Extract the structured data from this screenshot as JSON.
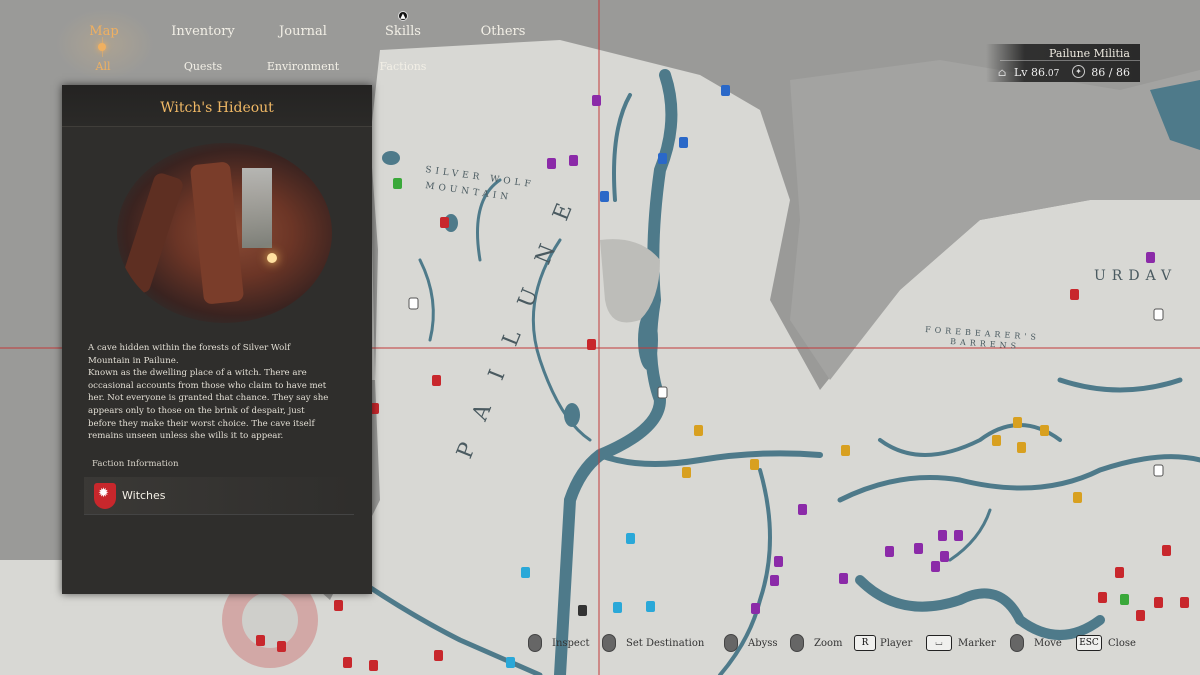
{
  "nav": {
    "main_tabs": [
      {
        "label": "Map",
        "active": true
      },
      {
        "label": "Inventory"
      },
      {
        "label": "Journal"
      },
      {
        "label": "Skills"
      },
      {
        "label": "Others"
      }
    ],
    "sub_tabs": [
      {
        "label": "All",
        "active": true
      },
      {
        "label": "Quests"
      },
      {
        "label": "Environment"
      },
      {
        "label": "Factions"
      }
    ]
  },
  "status": {
    "title": "Pailune Militia",
    "lv_label": "Lv",
    "lv_value": "86",
    "lv_fraction": ".07",
    "faction_value": "86  /  86"
  },
  "panel": {
    "title": "Witch's Hideout",
    "description": "A cave hidden within the forests of Silver Wolf\nMountain in Pailune.\nKnown as the dwelling place of a witch. There are\noccasional accounts from those who claim to have met\nher. Not everyone is granted that chance. They say she\nappears only to those on the brink of despair, just\nbefore they make their worst choice. The cave itself\nremains unseen unless she wills it to appear.",
    "faction_label": "Faction Information",
    "faction_name": "Witches"
  },
  "map": {
    "region_labels": [
      "SILVER WOLF",
      "MOUNTAIN",
      "PAILUNE",
      "URDAV",
      "FOREBEARER'S",
      "BARRENS"
    ]
  },
  "controls": [
    {
      "key": "",
      "label": "Inspect"
    },
    {
      "key": "",
      "label": "Set Destination"
    },
    {
      "key": "",
      "label": "Abyss"
    },
    {
      "key": "",
      "label": "Zoom"
    },
    {
      "key": "R",
      "label": "Player"
    },
    {
      "key": "⌴",
      "label": "Marker"
    },
    {
      "key": "",
      "label": "Move"
    },
    {
      "key": "ESC",
      "label": "Close"
    }
  ],
  "colors": {
    "accent": "#f0b060",
    "water": "#4e7a8a",
    "land": "#d6d6d2",
    "fog": "#9a9a98",
    "faction_red": "#c8272c"
  }
}
